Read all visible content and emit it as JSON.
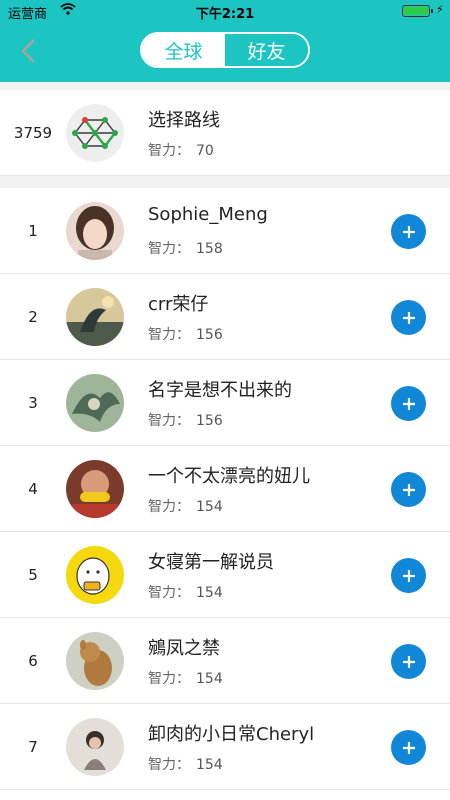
{
  "status_bar": {
    "carrier": "运营商",
    "time": "下午2:21",
    "battery_level": 1.0
  },
  "tabs": {
    "global": "全球",
    "friends": "好友"
  },
  "my_rank": {
    "rank": "3759",
    "name": "选择路线",
    "iq_label": "智力：",
    "iq_value": "70"
  },
  "leaderboard": [
    {
      "rank": "1",
      "name": "Sophie_Meng",
      "iq_label": "智力：",
      "iq_value": "158"
    },
    {
      "rank": "2",
      "name": "crr荣仔",
      "iq_label": "智力：",
      "iq_value": "156"
    },
    {
      "rank": "3",
      "name": "名字是想不出来的",
      "iq_label": "智力：",
      "iq_value": "156"
    },
    {
      "rank": "4",
      "name": "一个不太漂亮的妞儿",
      "iq_label": "智力：",
      "iq_value": "154"
    },
    {
      "rank": "5",
      "name": "女寝第一解说员",
      "iq_label": "智力：",
      "iq_value": "154"
    },
    {
      "rank": "6",
      "name": "鵷凤之禁",
      "iq_label": "智力：",
      "iq_value": "154"
    },
    {
      "rank": "7",
      "name": "卸肉的小日常Cheryl",
      "iq_label": "智力：",
      "iq_value": "154"
    }
  ],
  "colors": {
    "header": "#1cc4c2",
    "add_button": "#1187d8"
  }
}
